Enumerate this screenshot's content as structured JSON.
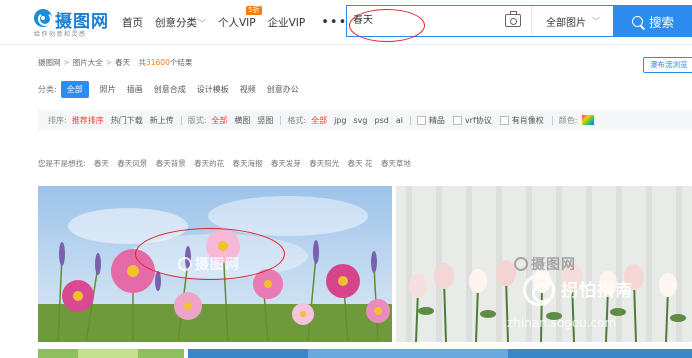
{
  "header": {
    "logo": {
      "name": "摄图网",
      "slogan": "给你创意和灵感"
    },
    "nav": [
      {
        "label": "首页",
        "dropdown": false
      },
      {
        "label": "创意分类",
        "dropdown": true
      },
      {
        "label": "个人VIP",
        "dropdown": false,
        "badge": "5折"
      },
      {
        "label": "企业VIP",
        "dropdown": false
      }
    ],
    "more": "•••",
    "search": {
      "value": "春天",
      "category": "全部图片",
      "button": "搜索"
    }
  },
  "breadcrumb": {
    "items": [
      "摄图网",
      "图片大全",
      "春天"
    ],
    "result_prefix": "共",
    "result_count": "31600",
    "result_suffix": "个结果"
  },
  "layout_button": "瀑布流浏览",
  "categories": {
    "label": "分类:",
    "items": [
      "全部",
      "照片",
      "插画",
      "创意合成",
      "设计模板",
      "视频",
      "创意办公"
    ],
    "active_index": 0
  },
  "sortbar": {
    "sort_label": "排序:",
    "sorts": [
      "推荐排序",
      "热门下载",
      "新上传"
    ],
    "active_sort": 0,
    "layout_label": "版式:",
    "layouts": [
      "全部",
      "横图",
      "竖图"
    ],
    "active_layout": 0,
    "format_label": "格式:",
    "formats": [
      "全部",
      "jpg",
      "svg",
      "psd",
      "ai"
    ],
    "active_format": 0,
    "checks": [
      "精品",
      "vrf协议",
      "有肖像权"
    ],
    "color_label": "颜色:"
  },
  "suggestions": {
    "label": "您是不是想找:",
    "items": [
      "春天",
      "春天风景",
      "春天背景",
      "春天的花",
      "春天海报",
      "春天发芽",
      "春天阳光",
      "春天 花",
      "春天草地"
    ]
  },
  "images": {
    "watermark": "摄图网",
    "overlay_text": "拐怕指南",
    "overlay_url": "zhinan.sogou.com"
  },
  "colors": {
    "accent": "#2d8cf0",
    "annotation": "#e0252b",
    "highlight": "#ff3b30",
    "count": "#ff7a00"
  }
}
